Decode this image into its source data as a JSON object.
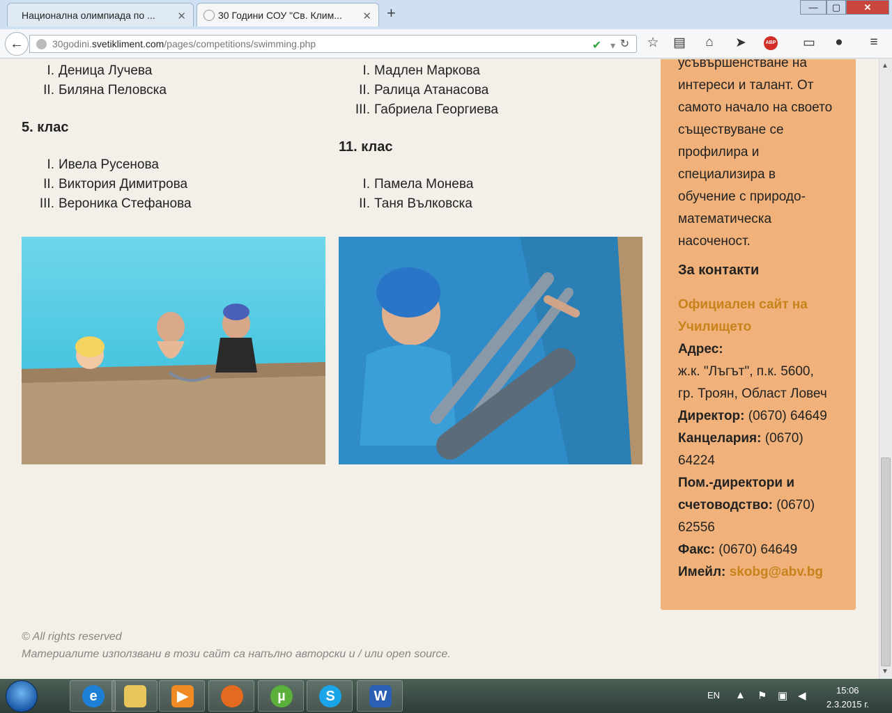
{
  "browser": {
    "tabs": [
      {
        "title": "Национална олимпиада по ...",
        "active": false
      },
      {
        "title": "30 Години СОУ \"Св. Клим...",
        "active": true
      }
    ],
    "url_prefix": "30godini.",
    "url_host": "svetikliment.com",
    "url_path": "/pages/competitions/swimming.php",
    "window_controls": {
      "minimize": "—",
      "maximize": "▢",
      "close": "✕"
    }
  },
  "content": {
    "left_col": {
      "list_top": [
        {
          "num": "I.",
          "name": "Деница Лучева"
        },
        {
          "num": "II.",
          "name": "Биляна Пеловска"
        }
      ],
      "grade5_heading": "5. клас",
      "grade5": [
        {
          "num": "I.",
          "name": "Ивела Русенова"
        },
        {
          "num": "II.",
          "name": "Виктория Димитрова"
        },
        {
          "num": "III.",
          "name": "Вероника Стефанова"
        }
      ]
    },
    "right_col": {
      "list_top": [
        {
          "num": "I.",
          "name": "Мадлен Маркова"
        },
        {
          "num": "II.",
          "name": "Ралица Атанасова"
        },
        {
          "num": "III.",
          "name": "Габриела Георгиева"
        }
      ],
      "grade11_heading": "11. клас",
      "grade11": [
        {
          "num": "I.",
          "name": "Памела Монева"
        },
        {
          "num": "II.",
          "name": "Таня Вълковска"
        }
      ]
    }
  },
  "sidebar": {
    "intro_lines": [
      "усъвършенстване на",
      "интереси и талант. От",
      "самото начало на своето",
      "съществуване се",
      "профилира и",
      "специализира в",
      "обучение с природо-",
      "математическа",
      "насоченост."
    ],
    "contacts_heading": "За контакти",
    "official_site_line1": "Официален сайт на",
    "official_site_line2": "Училището",
    "address_label": "Адрес:",
    "address_line1": "ж.к. \"Лъгът\", п.к. 5600,",
    "address_line2": "гр. Троян, Област Ловеч",
    "director_label": "Директор:",
    "director_phone": " (0670) 64649",
    "office_label": "Канцелария:",
    "office_phone_a": " (0670)",
    "office_phone_b": "64224",
    "deputy_label_1": "Пом.-директори и",
    "deputy_label_2": "счетоводство:",
    "deputy_phone_a": " (0670)",
    "deputy_phone_b": "62556",
    "fax_label": "Факс:",
    "fax_phone": " (0670) 64649",
    "email_label": "Имейл:",
    "email": " skobg@abv.bg"
  },
  "footer": {
    "rights": "© All rights reserved",
    "note": "Материалите използвани в този сайт са напълно авторски и / или open source."
  },
  "taskbar": {
    "lang": "EN",
    "time": "15:06",
    "date": "2.3.2015 г.",
    "apps": [
      "internet-explorer",
      "file-explorer",
      "media-player",
      "firefox",
      "utorrent",
      "skype",
      "word"
    ]
  }
}
